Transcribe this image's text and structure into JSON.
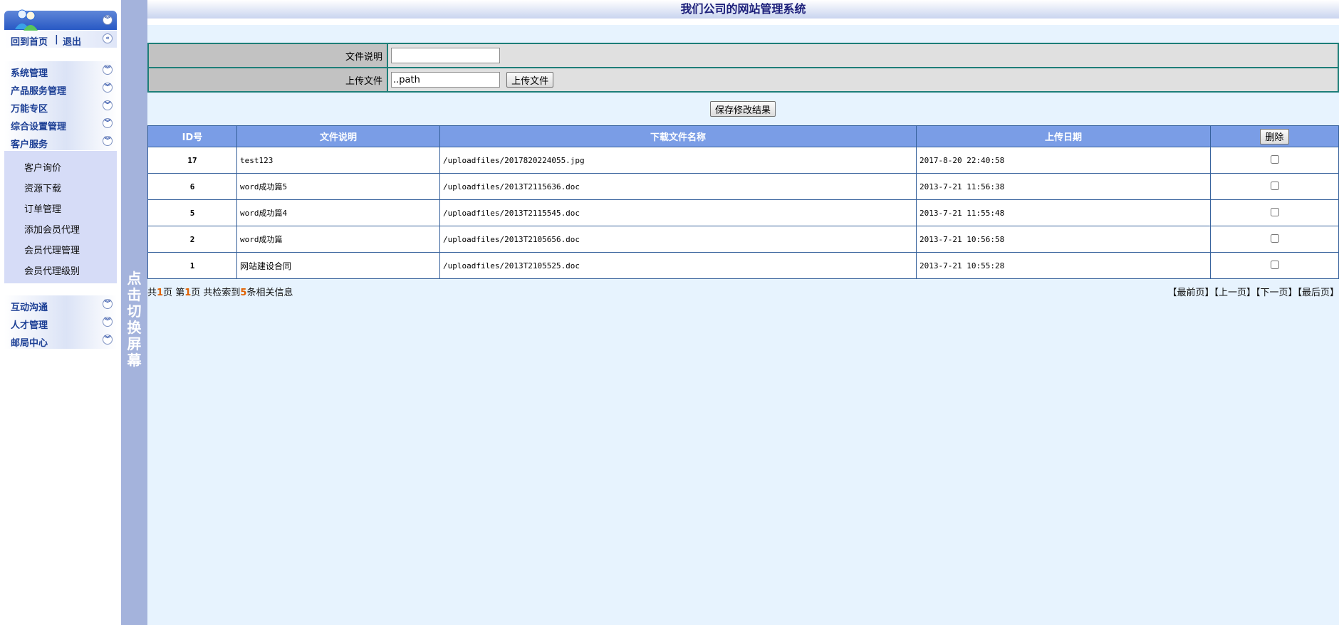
{
  "sidebar": {
    "home_link": "回到首页",
    "separator": "|",
    "logout_link": "退出",
    "menus_top": [
      {
        "label": "系统管理"
      },
      {
        "label": "产品服务管理"
      },
      {
        "label": "万能专区"
      },
      {
        "label": "综合设置管理"
      },
      {
        "label": "客户服务"
      }
    ],
    "sub_items": [
      {
        "label": "客户询价"
      },
      {
        "label": "资源下载"
      },
      {
        "label": "订单管理"
      },
      {
        "label": "添加会员代理"
      },
      {
        "label": "会员代理管理"
      },
      {
        "label": "会员代理级别"
      }
    ],
    "menus_bottom": [
      {
        "label": "互动沟通"
      },
      {
        "label": "人才管理"
      },
      {
        "label": "邮局中心"
      }
    ]
  },
  "switchbar": {
    "text": "点击切换屏幕"
  },
  "header": {
    "title": "我们公司的网站管理系统"
  },
  "form": {
    "desc_label": "文件说明",
    "desc_value": "",
    "upload_label": "上传文件",
    "upload_value": "..path",
    "upload_button": "上传文件",
    "save_button": "保存修改结果"
  },
  "table": {
    "headers": {
      "id": "ID号",
      "desc": "文件说明",
      "filename": "下载文件名称",
      "date": "上传日期",
      "delete_button": "删除"
    },
    "rows": [
      {
        "id": "17",
        "desc": "test123",
        "filename": "/uploadfiles/2017820224055.jpg",
        "date": "2017-8-20 22:40:58"
      },
      {
        "id": "6",
        "desc": "word成功篇5",
        "filename": "/uploadfiles/2013T2115636.doc",
        "date": "2013-7-21 11:56:38"
      },
      {
        "id": "5",
        "desc": "word成功篇4",
        "filename": "/uploadfiles/2013T2115545.doc",
        "date": "2013-7-21 11:55:48"
      },
      {
        "id": "2",
        "desc": "word成功篇",
        "filename": "/uploadfiles/2013T2105656.doc",
        "date": "2013-7-21 10:56:58"
      },
      {
        "id": "1",
        "desc": "网站建设合同",
        "filename": "/uploadfiles/2013T2105525.doc",
        "date": "2013-7-21 10:55:28"
      }
    ]
  },
  "pager": {
    "total_pages_prefix": "共",
    "total_pages": "1",
    "total_pages_suffix": "页 第",
    "current_page": "1",
    "current_page_suffix": "页 共检索到",
    "record_count": "5",
    "record_suffix": "条相关信息",
    "first": "【最前页】",
    "prev": "【上一页】",
    "next": "【下一页】",
    "last": "【最后页】"
  },
  "colors": {
    "table_header": "#7a9de6",
    "border": "#1d7e78",
    "page_bg": "#e7f3fe",
    "sidebar_text": "#1c3f95"
  }
}
